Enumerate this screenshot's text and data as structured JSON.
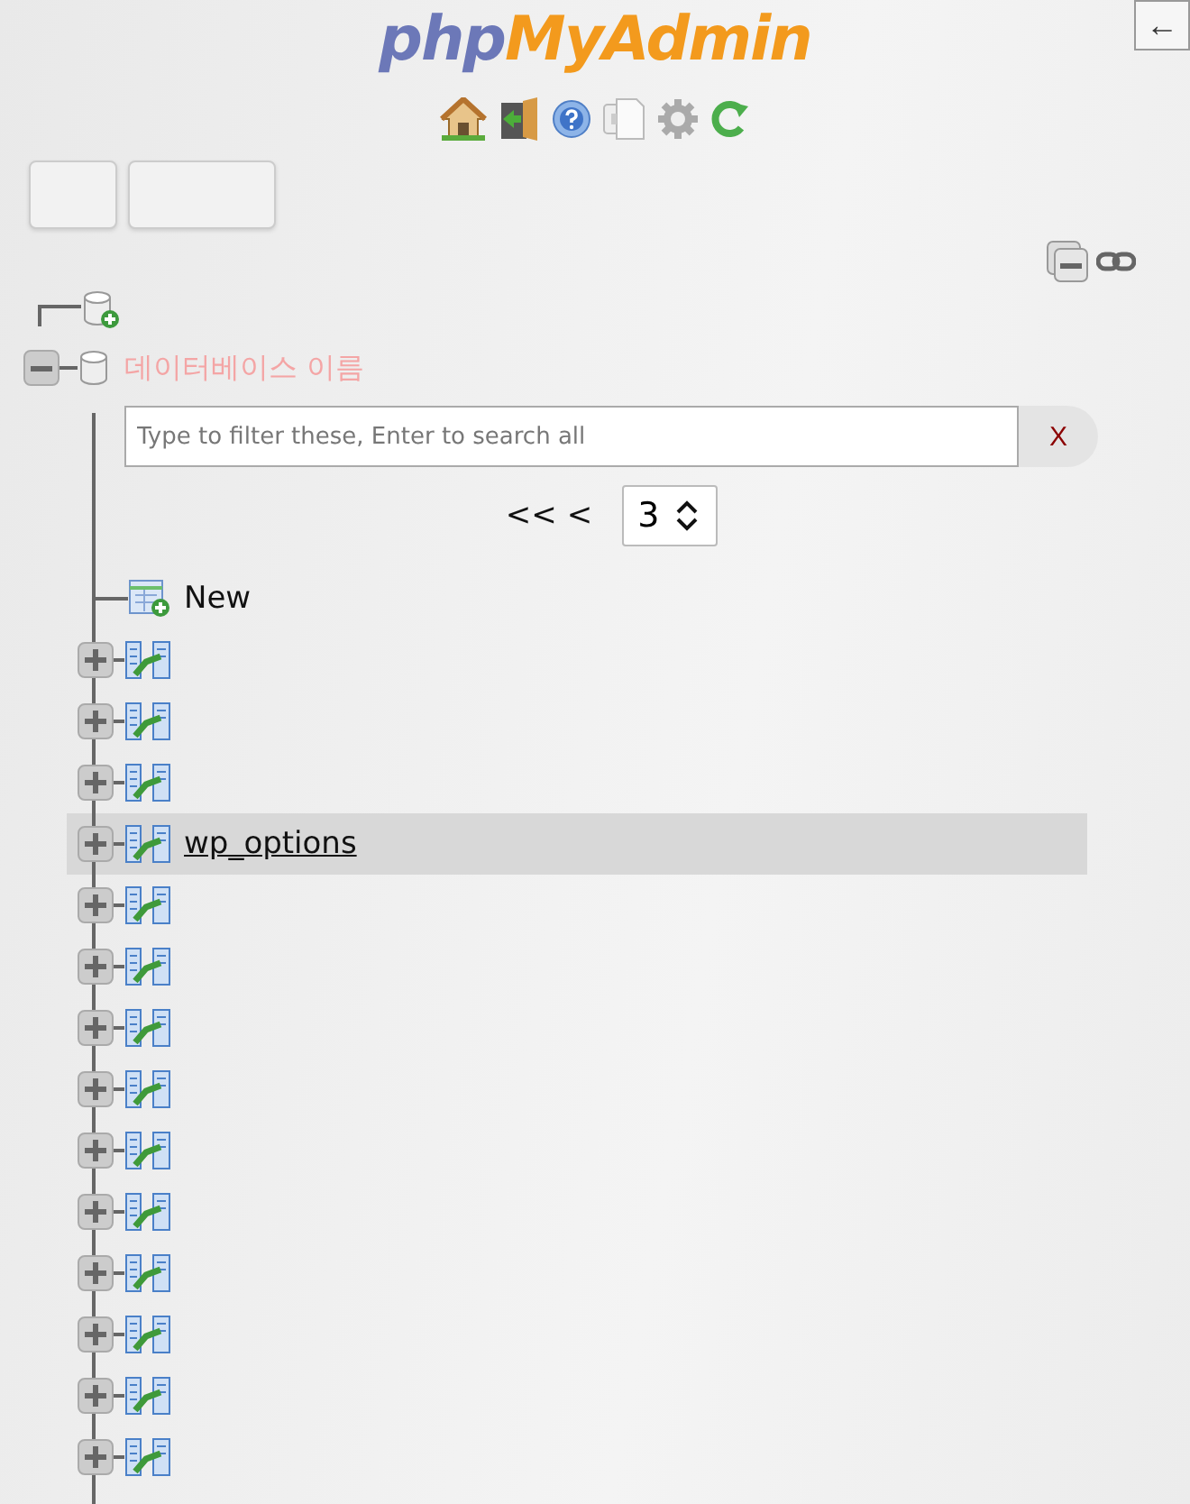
{
  "logo": {
    "first": "php",
    "second": "MyAdmin"
  },
  "back_button": {
    "label": "←"
  },
  "tree": {
    "database": {
      "name": "데이터베이스 이름",
      "expanded": true
    },
    "filter": {
      "placeholder": "Type to filter these, Enter to search all",
      "clear": "X"
    },
    "pager": {
      "prev": "<< <",
      "page": "3"
    },
    "new_item": {
      "label": "New"
    },
    "tables": [
      {
        "selected": false
      },
      {
        "selected": false
      },
      {
        "selected": false
      },
      {
        "name": "wp_options",
        "selected": true
      },
      {
        "selected": false
      },
      {
        "selected": false
      },
      {
        "selected": false
      },
      {
        "selected": false
      },
      {
        "selected": false
      },
      {
        "selected": false
      },
      {
        "selected": false
      },
      {
        "selected": false
      },
      {
        "selected": false
      },
      {
        "selected": false
      }
    ]
  }
}
